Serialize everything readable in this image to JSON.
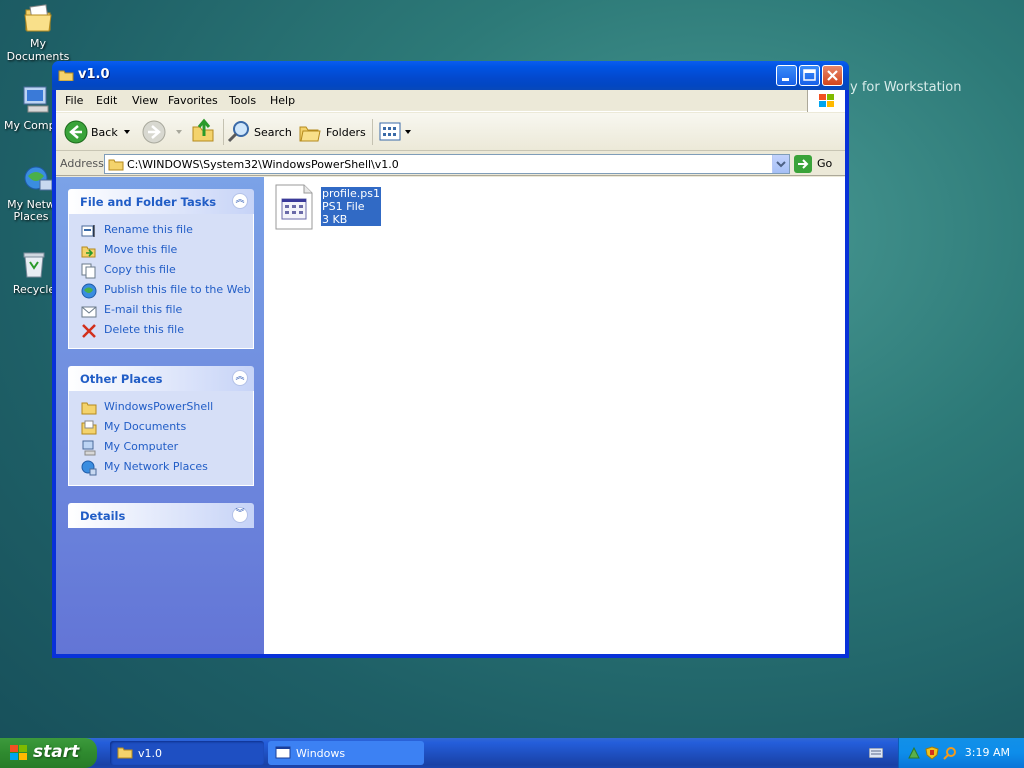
{
  "desktop": {
    "icons": [
      {
        "label": "My Documents"
      },
      {
        "label": "My Comp"
      },
      {
        "label": "My Netw Places"
      },
      {
        "label": "Recycle"
      }
    ],
    "wallpaper_text": "y for Workstation"
  },
  "window": {
    "title": "v1.0",
    "menu": [
      "File",
      "Edit",
      "View",
      "Favorites",
      "Tools",
      "Help"
    ],
    "toolbar": {
      "back": "Back",
      "search": "Search",
      "folders": "Folders"
    },
    "address": {
      "label": "Address",
      "path": "C:\\WINDOWS\\System32\\WindowsPowerShell\\v1.0",
      "go": "Go"
    },
    "panels": {
      "file_tasks": {
        "title": "File and Folder Tasks",
        "items": [
          {
            "label": "Rename this file",
            "icon": "rename-icon"
          },
          {
            "label": "Move this file",
            "icon": "move-icon"
          },
          {
            "label": "Copy this file",
            "icon": "copy-icon"
          },
          {
            "label": "Publish this file to the Web",
            "icon": "globe-icon"
          },
          {
            "label": "E-mail this file",
            "icon": "email-icon"
          },
          {
            "label": "Delete this file",
            "icon": "delete-icon"
          }
        ]
      },
      "other_places": {
        "title": "Other Places",
        "items": [
          {
            "label": "WindowsPowerShell",
            "icon": "folder-icon"
          },
          {
            "label": "My Documents",
            "icon": "documents-icon"
          },
          {
            "label": "My Computer",
            "icon": "computer-icon"
          },
          {
            "label": "My Network Places",
            "icon": "network-icon"
          }
        ]
      },
      "details": {
        "title": "Details"
      }
    },
    "files": [
      {
        "name": "profile.ps1",
        "type": "PS1 File",
        "size": "3 KB",
        "selected": true
      }
    ]
  },
  "taskbar": {
    "start": "start",
    "tasks": [
      {
        "label": "v1.0",
        "active": true
      },
      {
        "label": "Windows",
        "active": false
      }
    ],
    "clock": "3:19 AM"
  },
  "colors": {
    "title_blue": "#0054e3",
    "link_blue": "#215dc6",
    "selection": "#316ac5",
    "start_green": "#3c9a3c"
  }
}
